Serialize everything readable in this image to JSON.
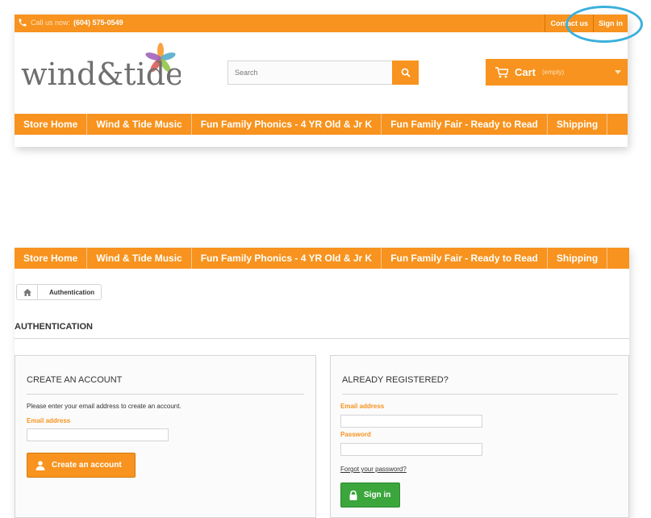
{
  "topbar": {
    "call_label": "Call us now:",
    "phone": "(604) 575-0549",
    "links": [
      "Contact us",
      "Sign in"
    ]
  },
  "search": {
    "placeholder": "Search"
  },
  "cart": {
    "label": "Cart",
    "status": "(empty)"
  },
  "nav": {
    "items": [
      "Store Home",
      "Wind & Tide Music",
      "Fun Family Phonics - 4 YR Old & Jr K",
      "Fun Family Fair - Ready to Read",
      "Shipping"
    ]
  },
  "breadcrumb": {
    "current": "Authentication"
  },
  "page_title": "AUTHENTICATION",
  "create_account": {
    "title": "CREATE AN ACCOUNT",
    "intro": "Please enter your email address to create an account.",
    "email_label": "Email address",
    "button_label": "Create an account"
  },
  "login": {
    "title": "ALREADY REGISTERED?",
    "email_label": "Email address",
    "password_label": "Password",
    "forgot_link": "Forgot your password?",
    "button_label": "Sign in"
  },
  "colors": {
    "accent": "#f7931e",
    "success": "#3aa63c",
    "highlight": "#3ab0dc"
  },
  "icons": [
    "phone-icon",
    "search-icon",
    "cart-icon",
    "home-icon",
    "user-icon",
    "lock-icon",
    "logo-flower-icon"
  ]
}
